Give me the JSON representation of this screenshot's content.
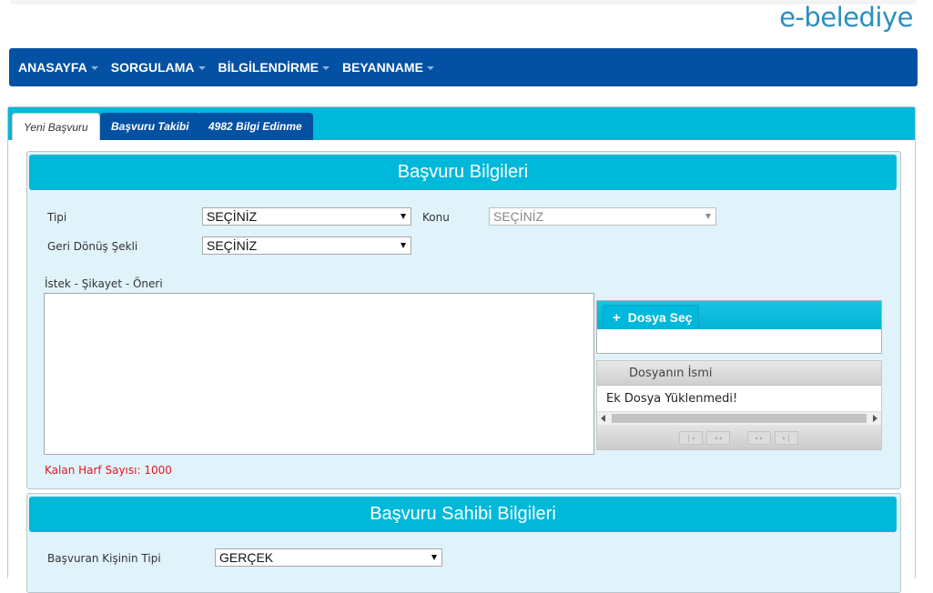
{
  "brand": "e-belediye",
  "nav": {
    "items": [
      {
        "label": "ANASAYFA"
      },
      {
        "label": "SORGULAMA"
      },
      {
        "label": "BİLGİLENDİRME"
      },
      {
        "label": "BEYANNAME"
      }
    ]
  },
  "tabs": [
    {
      "label": "Yeni Başvuru"
    },
    {
      "label": "Başvuru Takibi"
    },
    {
      "label": "4982 Bilgi Edinme"
    }
  ],
  "application": {
    "title": "Başvuru Bilgileri",
    "tipi_label": "Tipi",
    "tipi_value": "SEÇİNİZ",
    "konu_label": "Konu",
    "konu_value": "SEÇİNİZ",
    "geri_label": "Geri Dönüş Şekli",
    "geri_value": "SEÇİNİZ",
    "message_label": "İstek - Şikayet - Öneri",
    "message_value": "",
    "counter_label": "Kalan Harf Sayısı: 1000"
  },
  "upload": {
    "button_label": "Dosya Seç",
    "column_header": "Dosyanın İsmi",
    "empty_text": "Ek Dosya Yüklenmedi!",
    "pager": [
      "|◂",
      "◂◂",
      "▸▸",
      "▸|"
    ]
  },
  "applicant": {
    "title": "Başvuru Sahibi Bilgileri",
    "type_label": "Başvuran Kişinin Tipi",
    "type_value": "GERÇEK"
  },
  "colors": {
    "nav_bg": "#0451a3",
    "accent": "#00b8d9",
    "panel_bg": "#e0f3fb",
    "warning_text": "#e8141e",
    "brand_text": "#2a8ec0"
  }
}
